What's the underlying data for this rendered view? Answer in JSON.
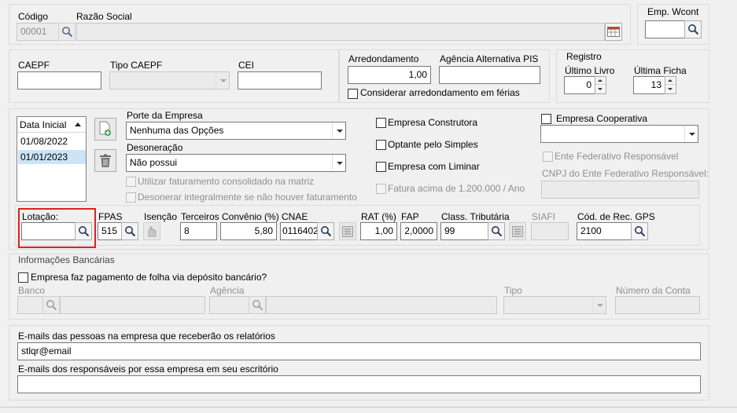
{
  "company": {
    "code_label": "Código",
    "code_value": "00001",
    "razao_label": "Razão Social",
    "razao_value": ""
  },
  "emp_wcont": {
    "label": "Emp. Wcont",
    "value": ""
  },
  "caepf": {
    "label": "CAEPF",
    "value": ""
  },
  "tipo_caepf": {
    "label": "Tipo CAEPF",
    "value": ""
  },
  "cei": {
    "label": "CEI",
    "value": ""
  },
  "arredondamento": {
    "label": "Arredondamento",
    "value": "1,00",
    "agencia_label": "Agência Alternativa PIS",
    "agencia_value": "",
    "considerar_label": "Considerar arredondamento em férias"
  },
  "registro": {
    "title": "Registro",
    "ultimo_livro_label": "Último Livro",
    "ultimo_livro_value": "0",
    "ultima_ficha_label": "Última Ficha",
    "ultima_ficha_value": "13"
  },
  "date_list": {
    "header": "Data Inicial",
    "rows": [
      "01/08/2022",
      "01/01/2023"
    ]
  },
  "porte": {
    "label": "Porte da Empresa",
    "value": "Nenhuma das Opções"
  },
  "desoneracao": {
    "label": "Desoneração",
    "value": "Não possui"
  },
  "checks_mid": {
    "utilizar": "Utilizar faturamento consolidado na matriz",
    "desonerar": "Desonerar integralmente se não houver faturamento"
  },
  "checks_right": {
    "construtora": "Empresa Construtora",
    "simples": "Optante pelo Simples",
    "liminar": "Empresa com Liminar",
    "fatura": "Fatura acima de 1.200.000 / Ano"
  },
  "cooperativa": {
    "label": "Empresa Cooperativa",
    "value": "",
    "ente_label": "Ente Federativo Responsável",
    "cnpj_label": "CNPJ do Ente Federativo Responsável:",
    "cnpj_value": ""
  },
  "taxes": {
    "lotacao_label": "Lotação:",
    "lotacao_value": "",
    "fpas_label": "FPAS",
    "fpas_value": "515",
    "isencao_label": "Isenção",
    "terceiros_label": "Terceiros",
    "terceiros_value": "8",
    "convenio_label": "Convênio (%)",
    "convenio_value": "5,80",
    "cnae_label": "CNAE",
    "cnae_value": "0116402",
    "rat_label": "RAT (%)",
    "rat_value": "1,00",
    "fap_label": "FAP",
    "fap_value": "2,0000",
    "class_label": "Class. Tributária",
    "class_value": "99",
    "siafi_label": "SIAFI",
    "siafi_value": "",
    "gps_label": "Cód. de Rec. GPS",
    "gps_value": "2100"
  },
  "bank": {
    "title": "Informações Bancárias",
    "deposito_label": "Empresa faz pagamento de folha via depósito bancário?",
    "banco_label": "Banco",
    "agencia_label": "Agência",
    "tipo_label": "Tipo",
    "conta_label": "Número da Conta"
  },
  "emails": {
    "pessoas_label": "E-mails das pessoas na empresa que receberão os relatórios",
    "pessoas_value": "stlqr@email",
    "resp_label": "E-mails dos responsáveis por essa empresa em seu escritório",
    "resp_value": ""
  },
  "colors": {
    "highlight": "#e02020",
    "selection": "#cce4f7"
  }
}
